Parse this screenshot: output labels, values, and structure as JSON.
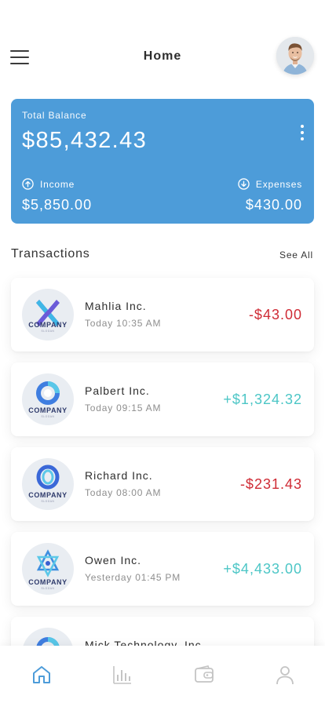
{
  "header": {
    "title": "Home",
    "menu_icon": "hamburger-menu-icon",
    "avatar_icon": "user-avatar"
  },
  "balance": {
    "label": "Total Balance",
    "amount": "$85,432.43",
    "income_label": "Income",
    "income_amount": "$5,850.00",
    "expenses_label": "Expenses",
    "expenses_amount": "$430.00",
    "card_color": "#4d9cd9"
  },
  "transactions": {
    "title": "Transactions",
    "see_all": "See All",
    "items": [
      {
        "name": "Mahlia Inc.",
        "time": "Today 10:35 AM",
        "amount": "-$43.00",
        "logo_text": "COMPANY",
        "logo_sub": "SLOGAN"
      },
      {
        "name": "Palbert Inc.",
        "time": "Today 09:15 AM",
        "amount": "+$1,324.32",
        "logo_text": "COMPANY",
        "logo_sub": "SLOGAN"
      },
      {
        "name": "Richard Inc.",
        "time": "Today 08:00 AM",
        "amount": "-$231.43",
        "logo_text": "COMPANY",
        "logo_sub": "SLOGAN"
      },
      {
        "name": "Owen Inc.",
        "time": "Yesterday 01:45 PM",
        "amount": "+$4,433.00",
        "logo_text": "COMPANY",
        "logo_sub": "SLOGAN"
      },
      {
        "name": "Mick Technology, Inc."
      }
    ]
  },
  "colors": {
    "negative": "#cf2b35",
    "positive": "#4cc6c6",
    "nav_active": "#4d9cd9",
    "nav_inactive": "#c4c4c4"
  },
  "bottom_nav": {
    "items": [
      "home-icon",
      "stats-icon",
      "wallet-icon",
      "profile-icon"
    ]
  }
}
